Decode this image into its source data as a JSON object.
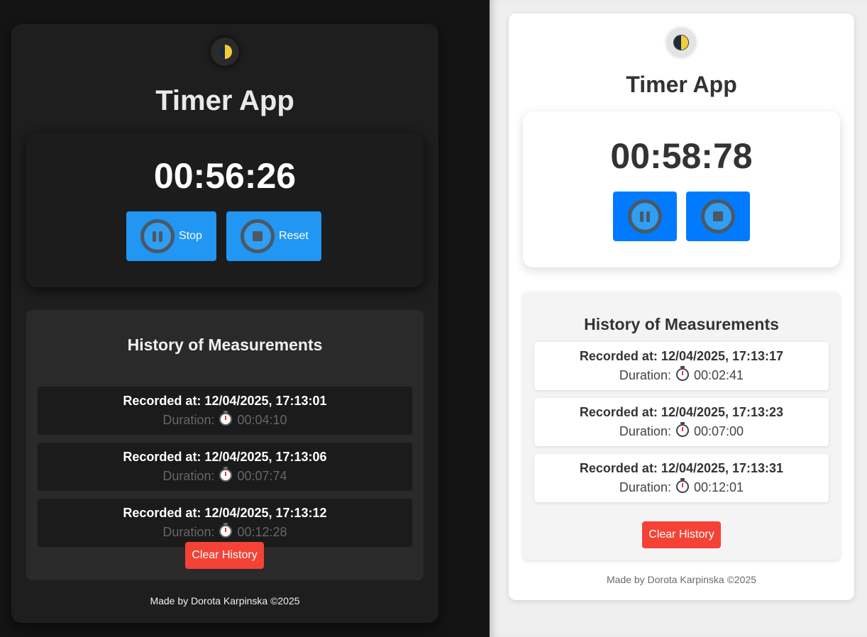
{
  "dark": {
    "title": "Timer App",
    "theme_toggle_icon": "moon-half-icon",
    "timer": "00:56:26",
    "buttons": {
      "stop_label": "Stop",
      "reset_label": "Reset"
    },
    "history": {
      "title": "History of Measurements",
      "entries": [
        {
          "recorded": "Recorded at: 12/04/2025, 17:13:01",
          "duration_label": "Duration:",
          "duration": "00:04:10"
        },
        {
          "recorded": "Recorded at: 12/04/2025, 17:13:06",
          "duration_label": "Duration:",
          "duration": "00:07:74"
        },
        {
          "recorded": "Recorded at: 12/04/2025, 17:13:12",
          "duration_label": "Duration:",
          "duration": "00:12:28"
        }
      ],
      "clear_label": "Clear History"
    },
    "footer": "Made by Dorota Karpinska ©2025",
    "colors": {
      "primary": "#2196f3",
      "danger": "#f44336",
      "background": "#1e1e1e"
    }
  },
  "light": {
    "title": "Timer App",
    "theme_toggle_icon": "moon-half-icon",
    "timer": "00:58:78",
    "history": {
      "title": "History of Measurements",
      "entries": [
        {
          "recorded": "Recorded at: 12/04/2025, 17:13:17",
          "duration_label": "Duration:",
          "duration": "00:02:41"
        },
        {
          "recorded": "Recorded at: 12/04/2025, 17:13:23",
          "duration_label": "Duration:",
          "duration": "00:07:00"
        },
        {
          "recorded": "Recorded at: 12/04/2025, 17:13:31",
          "duration_label": "Duration:",
          "duration": "00:12:01"
        }
      ],
      "clear_label": "Clear History"
    },
    "footer": "Made by Dorota Karpinska ©2025",
    "colors": {
      "primary": "#007bff",
      "danger": "#f44336",
      "background": "#ffffff"
    }
  }
}
